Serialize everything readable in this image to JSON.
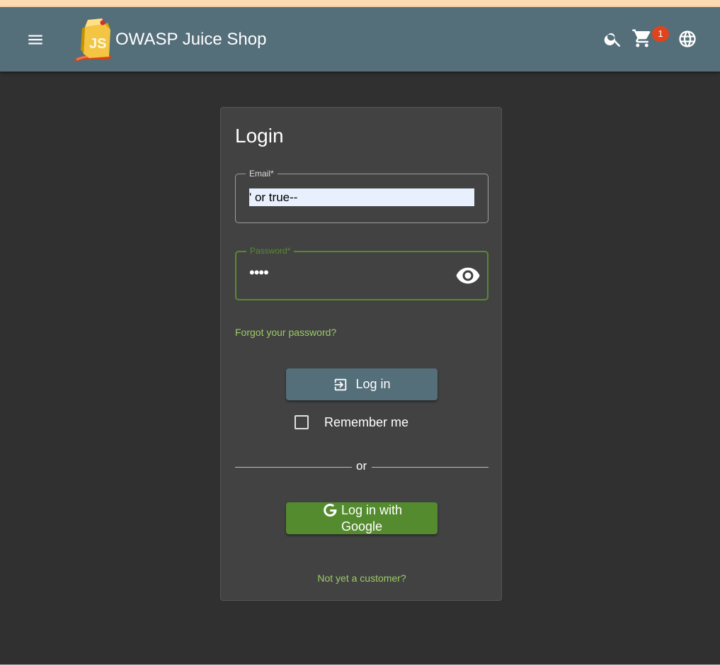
{
  "header": {
    "app_title": "OWASP Juice Shop",
    "cart_count": "1",
    "icons": {
      "menu": "menu-icon",
      "logo": "juice-shop-logo",
      "search": "search-icon",
      "cart": "shopping-cart-icon",
      "language": "globe-icon"
    }
  },
  "login": {
    "title": "Login",
    "email_label": "Email*",
    "email_value": "' or true--",
    "password_label": "Password*",
    "password_value": "••••",
    "forgot_password": "Forgot your password?",
    "login_button": "Log in",
    "remember_me": "Remember me",
    "remember_checked": false,
    "or": "or",
    "google_button_line1": "Log in with",
    "google_button_line2": "Google",
    "register_link": "Not yet a customer?"
  },
  "colors": {
    "toolbar": "#546e7a",
    "background": "#303030",
    "card": "#424242",
    "accent_green": "#558b2f",
    "link_green": "#9ccc65",
    "badge": "#e0441c"
  }
}
